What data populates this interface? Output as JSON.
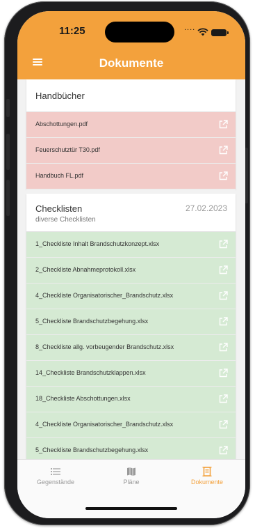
{
  "status": {
    "time": "11:25",
    "dots": "...."
  },
  "header": {
    "title": "Dokumente"
  },
  "sections": [
    {
      "title": "Handbücher",
      "subtitle": "",
      "date": "",
      "color": "red",
      "items": [
        "Abschottungen.pdf",
        "Feuerschutztür T30.pdf",
        "Handbuch FL.pdf"
      ]
    },
    {
      "title": "Checklisten",
      "subtitle": "diverse Checklisten",
      "date": "27.02.2023",
      "color": "green",
      "items": [
        "1_Checkliste Inhalt Brandschutzkonzept.xlsx",
        "2_Checkliste  Abnahmeprotokoll.xlsx",
        "4_Checkliste Organisatorischer_Brandschutz.xlsx",
        "5_Checkliste Brandschutzbegehung.xlsx",
        "8_Checkliste allg. vorbeugender Brandschutz.xlsx",
        "14_Checkliste Brandschutzklappen.xlsx",
        "18_Checkliste Abschottungen.xlsx",
        "4_Checkliste Organisatorischer_Brandschutz.xlsx",
        "5_Checkliste Brandschutzbegehung.xlsx"
      ]
    }
  ],
  "tabs": [
    {
      "label": "Gegenstände",
      "icon": "list-icon",
      "active": false
    },
    {
      "label": "Pläne",
      "icon": "map-icon",
      "active": false
    },
    {
      "label": "Dokumente",
      "icon": "document-icon",
      "active": true
    }
  ],
  "colors": {
    "accent": "#f3a13c",
    "red_row": "#f2cbc8",
    "green_row": "#d5ead3",
    "inactive": "#999999"
  }
}
